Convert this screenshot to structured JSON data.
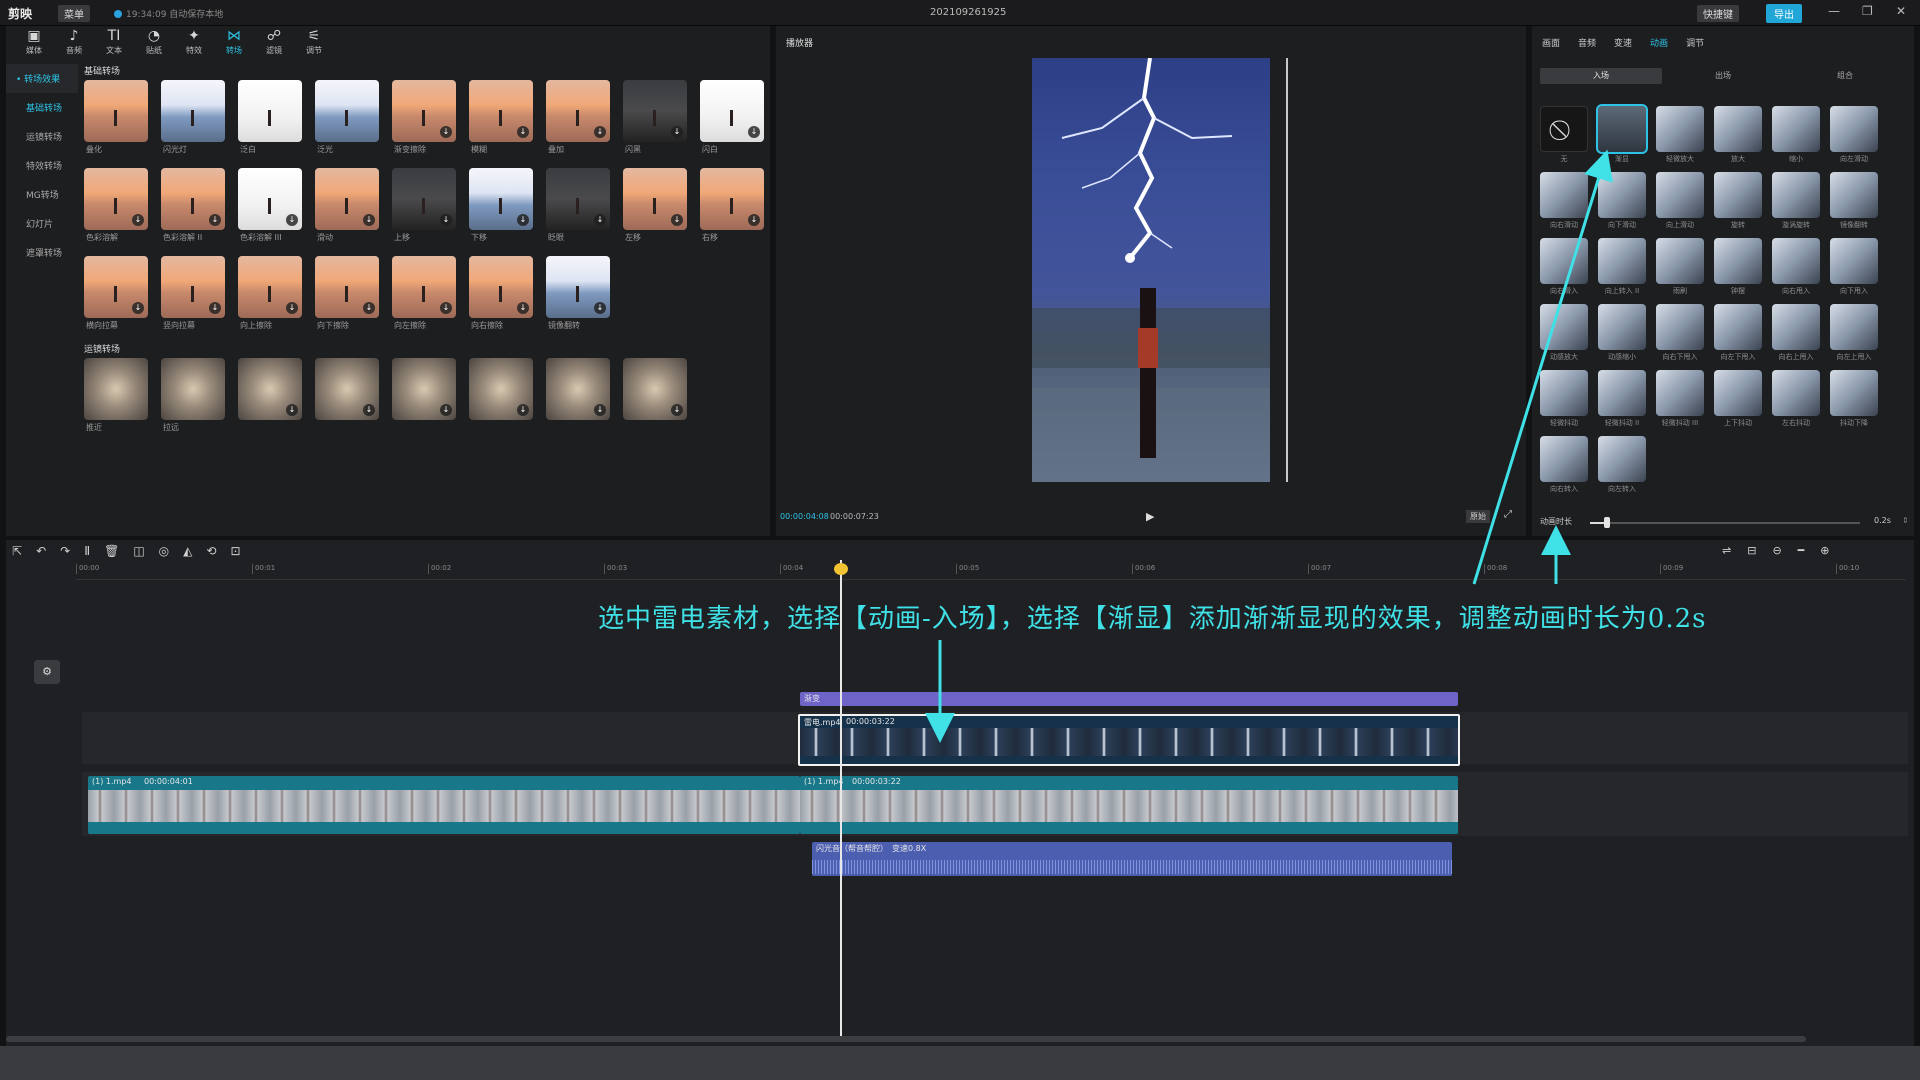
{
  "app": {
    "logo": "剪映",
    "menu_label": "菜单",
    "autosave": "19:34:09 自动保存本地",
    "project_title": "202109261925",
    "shortcut_label": "快捷键",
    "export_label": "导出",
    "window_controls": [
      "—",
      "❐",
      "✕"
    ]
  },
  "toolbar": {
    "tools": [
      {
        "label": "媒体",
        "icon": "▣"
      },
      {
        "label": "音频",
        "icon": "♪"
      },
      {
        "label": "文本",
        "icon": "TI"
      },
      {
        "label": "贴纸",
        "icon": "◔"
      },
      {
        "label": "特效",
        "icon": "✦"
      },
      {
        "label": "转场",
        "icon": "⋈"
      },
      {
        "label": "滤镜",
        "icon": "☍"
      },
      {
        "label": "调节",
        "icon": "⚟"
      }
    ],
    "active_index": 5
  },
  "sidenav": {
    "items": [
      "• 转场效果",
      "基础转场",
      "运镜转场",
      "特效转场",
      "MG转场",
      "幻灯片",
      "遮罩转场"
    ],
    "active_index": 1
  },
  "assets": {
    "section1_title": "基础转场",
    "basic": [
      "叠化",
      "闪光灯",
      "泛白",
      "泛光",
      "渐变擦除",
      "模糊",
      "叠加",
      "闪黑",
      "闪白",
      "色彩溶解",
      "色彩溶解 II",
      "色彩溶解 III",
      "滑动",
      "上移",
      "下移",
      "眨眼",
      "左移",
      "右移",
      "横向拉幕",
      "竖向拉幕",
      "向上擦除",
      "向下擦除",
      "向左擦除",
      "向右擦除",
      "镜像翻转"
    ],
    "section2_title": "运镜转场",
    "camera": [
      "推近",
      "拉远",
      "",
      "",
      "",
      "",
      "",
      ""
    ]
  },
  "player": {
    "header": "播放器",
    "current_time": "00:00:04:08",
    "total_time": "00:00:07:23",
    "ratio_label": "原始"
  },
  "inspector": {
    "tabs": [
      "画面",
      "音频",
      "变速",
      "动画",
      "调节"
    ],
    "active_tab": 3,
    "subtabs": [
      "入场",
      "出场",
      "组合"
    ],
    "active_subtab": 0,
    "animations": [
      "无",
      "渐显",
      "轻微放大",
      "放大",
      "缩小",
      "向左滑动",
      "向右滑动",
      "向下滑动",
      "向上滑动",
      "旋转",
      "漩涡旋转",
      "镜像翻转",
      "向右滑入",
      "向上转入 II",
      "雨刷",
      "钟摆",
      "向右甩入",
      "向下甩入",
      "动感放大",
      "动感缩小",
      "向右下甩入",
      "向左下甩入",
      "向右上甩入",
      "向左上甩入",
      "轻微抖动",
      "轻微抖动 II",
      "轻微抖动 III",
      "上下抖动",
      "左右抖动",
      "抖动下降",
      "向右转入",
      "向左转入"
    ],
    "selected_index": 1,
    "duration_label": "动画时长",
    "duration_value": "0.2s",
    "duration_fraction": 0.05
  },
  "timeline": {
    "tools": [
      "⇱",
      "↶",
      "↷",
      "Ⅱ",
      "🗑",
      "◫",
      "◎",
      "◭",
      "⟲",
      "⊡"
    ],
    "right_tools": [
      "⇌",
      "⊟",
      "⊖",
      "━",
      "⊕"
    ],
    "ruler": [
      "00:00",
      "00:01",
      "00:02",
      "00:03",
      "00:04",
      "00:05",
      "00:06",
      "00:07",
      "00:08",
      "00:09",
      "00:10"
    ],
    "transition_label": "渐变",
    "lightning_clip": {
      "name": "雷电.mp4",
      "duration": "00:00:03:22"
    },
    "main_clip_1": {
      "name": "(1) 1.mp4",
      "duration": "00:00:04:01"
    },
    "main_clip_2": {
      "name": "(1) 1.mp4",
      "duration": "00:00:03:22"
    },
    "audio_clip": {
      "name": "闪光音（帮音帮腔）",
      "speed": "变速0.8X"
    },
    "track_icon": "⚙"
  },
  "annotation": {
    "text": "选中雷电素材，选择【动画-入场】，选择【渐显】添加渐渐显现的效果，调整动画时长为0.2s"
  },
  "colors": {
    "accent": "#2ec3e6",
    "annotation": "#3fe0e6",
    "playhead": "#f1c232"
  }
}
